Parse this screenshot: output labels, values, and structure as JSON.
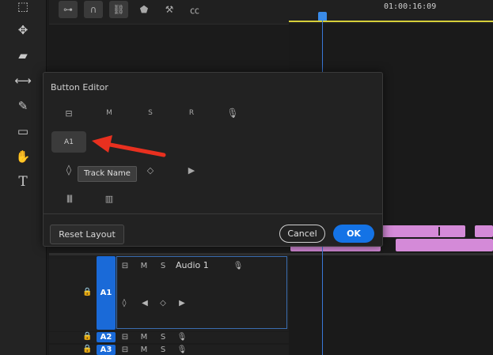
{
  "tools": [
    {
      "icon": "track-select-forward-icon",
      "glyph": "⬚"
    },
    {
      "icon": "ripple-edit-icon",
      "glyph": "✥"
    },
    {
      "icon": "razor-icon",
      "glyph": "▰"
    },
    {
      "icon": "slip-icon",
      "glyph": "⟷"
    },
    {
      "icon": "pen-icon",
      "glyph": "✎"
    },
    {
      "icon": "rectangle-icon",
      "glyph": "▭"
    },
    {
      "icon": "hand-icon",
      "glyph": "✋"
    },
    {
      "icon": "type-icon",
      "glyph": "T"
    }
  ],
  "timeline_toolbar": [
    {
      "icon": "nest-icon",
      "glyph": "⊶"
    },
    {
      "icon": "snap-icon",
      "glyph": "∩"
    },
    {
      "icon": "linked-selection-icon",
      "glyph": "⛓"
    },
    {
      "icon": "marker-icon",
      "glyph": "⬟"
    },
    {
      "icon": "settings-wrench-icon",
      "glyph": "🔧"
    },
    {
      "icon": "captions-icon",
      "glyph": "㏄"
    }
  ],
  "timeline": {
    "timecode": "01:00:16:09"
  },
  "dialog": {
    "title": "Button Editor",
    "buttons_row1": [
      {
        "icon": "toggle-sync-lock-icon",
        "glyph": "⊟"
      },
      {
        "icon": "mute-icon",
        "glyph": "M"
      },
      {
        "icon": "solo-icon",
        "glyph": "S"
      },
      {
        "icon": "record-icon",
        "glyph": "R"
      },
      {
        "icon": "microphone-icon",
        "glyph": "🎙"
      }
    ],
    "a1_chip": "A1",
    "buttons_row3": [
      {
        "icon": "keyframe-toggle-icon",
        "glyph": "◊"
      },
      {
        "icon": "add-keyframe-icon",
        "glyph": "◇"
      },
      {
        "icon": "next-keyframe-icon",
        "glyph": "▶"
      }
    ],
    "buttons_row4": [
      {
        "icon": "waveform-icon",
        "glyph": "⦙⦙"
      },
      {
        "icon": "meter-icon",
        "glyph": "▥"
      }
    ],
    "tooltip": "Track Name",
    "reset_label": "Reset Layout",
    "cancel_label": "Cancel",
    "ok_label": "OK"
  },
  "tracks": {
    "a1": {
      "label": "A1",
      "name": "Audio 1",
      "m": "M",
      "s": "S"
    },
    "a2": {
      "label": "A2",
      "m": "M",
      "s": "S"
    },
    "a3": {
      "label": "A3",
      "m": "M",
      "s": "S"
    }
  },
  "colors": {
    "accent": "#1473e6",
    "playhead": "#3a78d8",
    "clip": "#d48ad8",
    "workarea": "#d6cf3a"
  }
}
